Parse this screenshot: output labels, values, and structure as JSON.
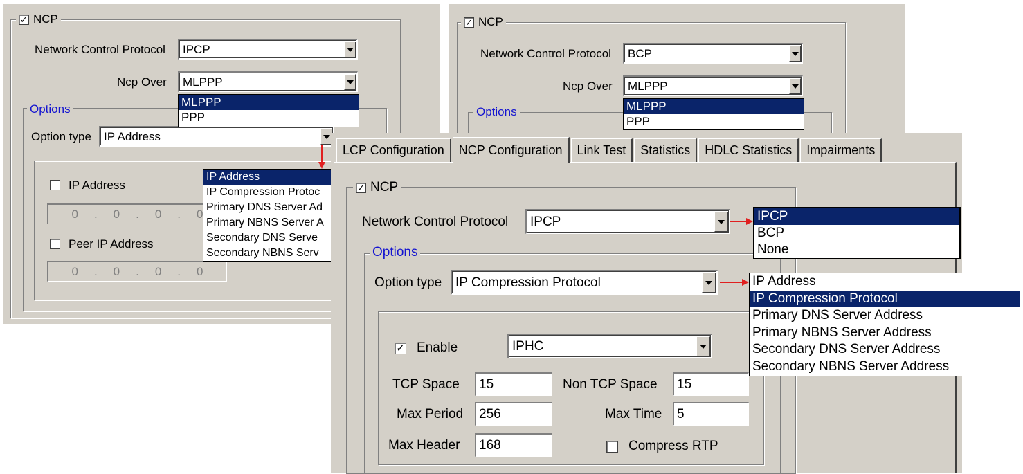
{
  "left_panel": {
    "ncp_label": "NCP",
    "ncp_checked": "✓",
    "protocol_label": "Network Control Protocol",
    "protocol_value": "IPCP",
    "ncp_over_label": "Ncp Over",
    "ncp_over_value": "MLPPP",
    "ncp_over_options": [
      "MLPPP",
      "PPP"
    ],
    "options_label": "Options",
    "option_type_label": "Option type",
    "option_type_value": "IP Address",
    "option_type_options": [
      "IP Address",
      "IP Compression Protoc",
      "Primary DNS Server Ad",
      "Primary NBNS Server A",
      "Secondary DNS Serve",
      "Secondary NBNS Serv"
    ],
    "ip_address_label": "IP Address",
    "peer_ip_address_label": "Peer IP Address",
    "ip_octets": [
      "0",
      "0",
      "0",
      "0"
    ],
    "peer_ip_octets": [
      "0",
      "0",
      "0",
      "0"
    ]
  },
  "middle_panel": {
    "ncp_label": "NCP",
    "ncp_checked": "✓",
    "protocol_label": "Network Control Protocol",
    "protocol_value": "BCP",
    "ncp_over_label": "Ncp Over",
    "ncp_over_value": "MLPPP",
    "ncp_over_options": [
      "MLPPP",
      "PPP"
    ],
    "options_label": "Options"
  },
  "front_panel": {
    "tabs": [
      "LCP Configuration",
      "NCP Configuration",
      "Link Test",
      "Statistics",
      "HDLC Statistics",
      "Impairments"
    ],
    "active_tab": "NCP Configuration",
    "ncp_label": "NCP",
    "ncp_checked": "✓",
    "protocol_label": "Network Control Protocol",
    "protocol_value": "IPCP",
    "protocol_options": [
      "IPCP",
      "BCP",
      "None"
    ],
    "options_label": "Options",
    "option_type_label": "Option type",
    "option_type_value": "IP Compression Protocol",
    "option_type_options": [
      "IP Address",
      "IP Compression Protocol",
      "Primary DNS Server Address",
      "Primary NBNS Server Address",
      "Secondary DNS Server Address",
      "Secondary NBNS Server Address"
    ],
    "enable_label": "Enable",
    "enable_checked": "✓",
    "enable_value": "IPHC",
    "tcp_space_label": "TCP Space",
    "tcp_space_value": "15",
    "non_tcp_space_label": "Non TCP Space",
    "non_tcp_space_value": "15",
    "max_period_label": "Max Period",
    "max_period_value": "256",
    "max_time_label": "Max Time",
    "max_time_value": "5",
    "max_header_label": "Max Header",
    "max_header_value": "168",
    "compress_rtp_label": "Compress RTP"
  },
  "colors": {
    "selection": "#0a246a",
    "arrow": "#e02020",
    "dialog": "#d4d0c8",
    "group_label": "#1414d0"
  }
}
